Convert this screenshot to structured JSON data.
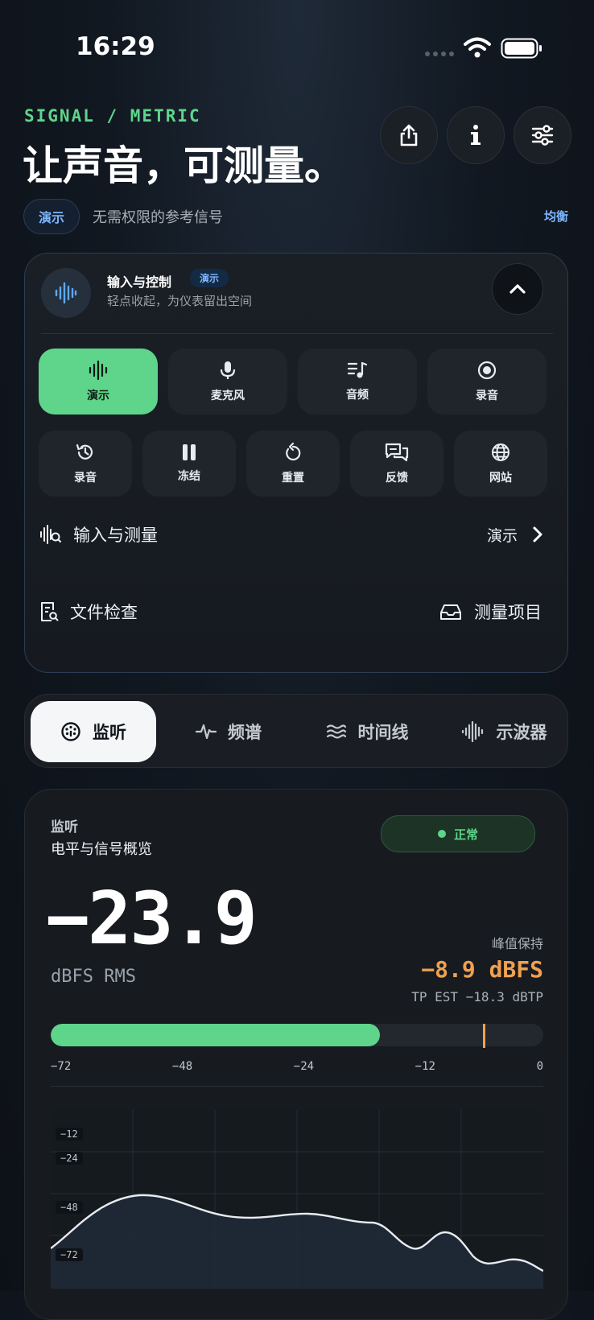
{
  "status_bar": {
    "time": "16:29"
  },
  "header": {
    "eyebrow": "SIGNAL / METRIC",
    "title": "让声音，可测量。",
    "mode_chip": "演示",
    "subtitle": "无需权限的参考信号",
    "right_link": "均衡"
  },
  "control_panel": {
    "title": "输入与控制",
    "badge": "演示",
    "hint": "轻点收起，为仪表留出空间",
    "sources": [
      {
        "label": "演示",
        "icon": "waveform-icon",
        "active": true
      },
      {
        "label": "麦克风",
        "icon": "microphone-icon",
        "active": false
      },
      {
        "label": "音频",
        "icon": "music-list-icon",
        "active": false
      },
      {
        "label": "录音",
        "icon": "record-icon",
        "active": false
      }
    ],
    "actions": [
      {
        "label": "录音",
        "icon": "history-icon"
      },
      {
        "label": "冻结",
        "icon": "pause-icon"
      },
      {
        "label": "重置",
        "icon": "reset-icon"
      },
      {
        "label": "反馈",
        "icon": "feedback-icon"
      },
      {
        "label": "网站",
        "icon": "globe-icon"
      }
    ],
    "input_row": {
      "label": "输入与测量",
      "value": "演示"
    },
    "file_check": "文件检查",
    "projects": "测量项目"
  },
  "tabs": [
    {
      "label": "监听",
      "icon": "meter-icon",
      "active": true
    },
    {
      "label": "频谱",
      "icon": "pulse-icon",
      "active": false
    },
    {
      "label": "时间线",
      "icon": "waves-icon",
      "active": false
    },
    {
      "label": "示波器",
      "icon": "oscilloscope-icon",
      "active": false
    }
  ],
  "monitor": {
    "section": "监听",
    "subtitle": "电平与信号概览",
    "status": "正常",
    "level": "−23.9",
    "unit": "dBFS RMS",
    "peak_label": "峰值保持",
    "peak_value": "−8.9 dBFS",
    "true_peak": "TP EST −18.3 dBTP",
    "meter_fraction": 0.668,
    "peak_fraction": 0.877,
    "scale": [
      "−72",
      "−48",
      "−24",
      "−12",
      "0"
    ],
    "graph_labels": [
      "−12",
      "−24",
      "−48",
      "−72"
    ],
    "colors": {
      "accent": "#5ed58a",
      "peak": "#f0a050",
      "link": "#7eb6ff"
    }
  }
}
